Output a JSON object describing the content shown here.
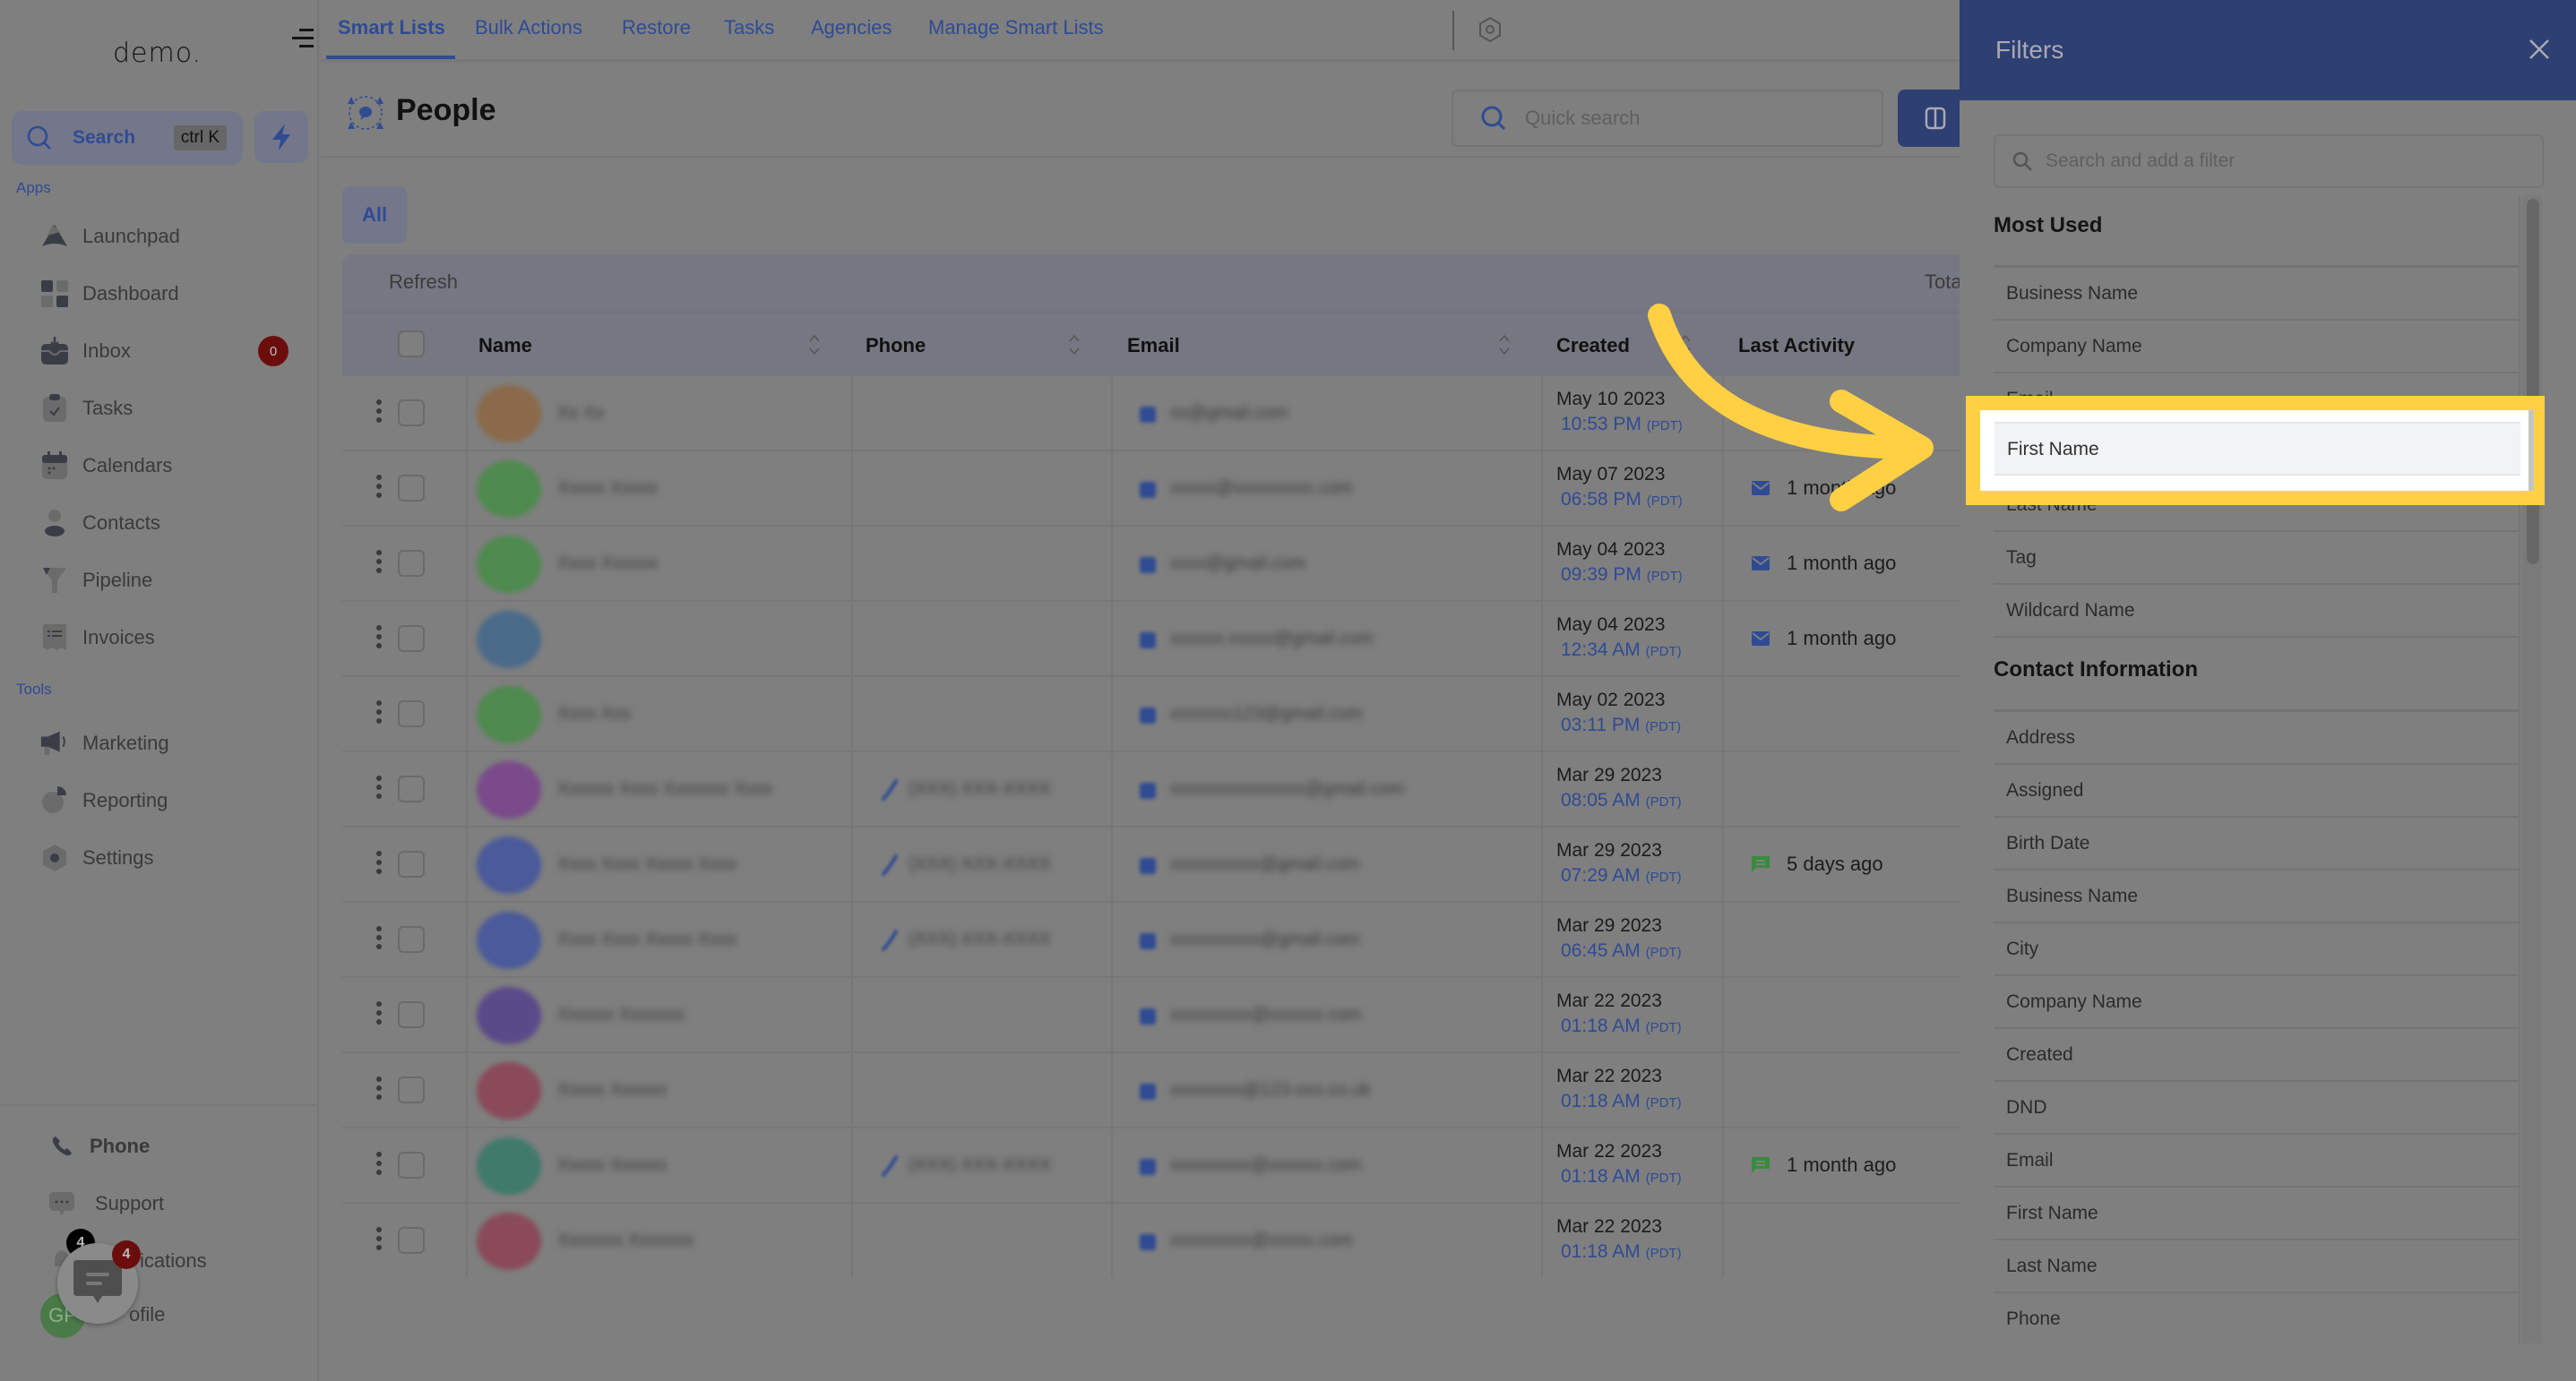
{
  "sidebar": {
    "logo": "demo.",
    "search_label": "Search",
    "search_shortcut": "ctrl K",
    "apps_label": "Apps",
    "tools_label": "Tools",
    "apps": [
      {
        "label": "Launchpad",
        "icon": "rocket-icon"
      },
      {
        "label": "Dashboard",
        "icon": "dashboard-icon"
      },
      {
        "label": "Inbox",
        "icon": "inbox-icon",
        "badge": "0"
      },
      {
        "label": "Tasks",
        "icon": "tasks-icon"
      },
      {
        "label": "Calendars",
        "icon": "calendar-icon"
      },
      {
        "label": "Contacts",
        "icon": "contacts-icon"
      },
      {
        "label": "Pipeline",
        "icon": "pipeline-icon"
      },
      {
        "label": "Invoices",
        "icon": "invoice-icon"
      }
    ],
    "tools": [
      {
        "label": "Marketing",
        "icon": "megaphone-icon"
      },
      {
        "label": "Reporting",
        "icon": "pie-chart-icon"
      },
      {
        "label": "Settings",
        "icon": "settings-icon"
      }
    ],
    "bottom": [
      {
        "label": "Phone",
        "icon": "phone-icon"
      },
      {
        "label": "Support",
        "icon": "support-icon"
      },
      {
        "label": "Notifications",
        "icon": "bell-icon",
        "visible_text": "ications",
        "badge": "4"
      },
      {
        "label": "Profile",
        "icon": "avatar",
        "visible_text": "ofile",
        "initials": "GP"
      }
    ],
    "chat_widget_badge": "4"
  },
  "topbar": {
    "tabs": [
      {
        "label": "Smart Lists",
        "active": true
      },
      {
        "label": "Bulk Actions"
      },
      {
        "label": "Restore"
      },
      {
        "label": "Tasks"
      },
      {
        "label": "Agencies"
      },
      {
        "label": "Manage Smart Lists"
      }
    ]
  },
  "page": {
    "title": "People",
    "quick_search_placeholder": "Quick search",
    "list_tab": "All",
    "refresh_label": "Refresh",
    "total_label": "Tota"
  },
  "table": {
    "columns": [
      "Name",
      "Phone",
      "Email",
      "Created",
      "Last Activity"
    ],
    "rows": [
      {
        "avatar_color": "#8a6a4a",
        "name": "Xx Xx",
        "phone": "",
        "email": "xx@gmail.com",
        "date": "May 10 2023",
        "time": "10:53 PM",
        "tz": "(PDT)",
        "activity": "",
        "activity_icon": ""
      },
      {
        "avatar_color": "#4f8a4f",
        "name": "Xxxxx Xxxxx",
        "phone": "",
        "email": "xxxxx@xxxxxxxxx.com",
        "date": "May 07 2023",
        "time": "06:58 PM",
        "tz": "(PDT)",
        "activity": "1 month ago",
        "activity_icon": "email"
      },
      {
        "avatar_color": "#4f8a4f",
        "name": "Xxxx Xxxxxx",
        "phone": "",
        "email": "xxxx@gmail.com",
        "date": "May 04 2023",
        "time": "09:39 PM",
        "tz": "(PDT)",
        "activity": "1 month ago",
        "activity_icon": "email"
      },
      {
        "avatar_color": "#4a6a8a",
        "name": "",
        "phone": "",
        "email": "xxxxxx.xxxxx@gmail.com",
        "date": "May 04 2023",
        "time": "12:34 AM",
        "tz": "(PDT)",
        "activity": "1 month ago",
        "activity_icon": "email"
      },
      {
        "avatar_color": "#4f8a4f",
        "name": "Xxxx Xxx",
        "phone": "",
        "email": "xxxxxxx123@gmail.com",
        "date": "May 02 2023",
        "time": "03:11 PM",
        "tz": "(PDT)",
        "activity": "",
        "activity_icon": ""
      },
      {
        "avatar_color": "#7a4a8a",
        "name": "Xxxxxx Xxxx Xxxxxxx Xxxx",
        "phone": "(XXX) XXX-XXXX",
        "email": "xxxxxxxxxxxxxxx@gmail.com",
        "date": "Mar 29 2023",
        "time": "08:05 AM",
        "tz": "(PDT)",
        "activity": "",
        "activity_icon": ""
      },
      {
        "avatar_color": "#4a5a9a",
        "name": "Xxxx Xxxx Xxxxx Xxxx",
        "phone": "(XXX) XXX-XXXX",
        "email": "xxxxxxxxxx@gmail.com",
        "date": "Mar 29 2023",
        "time": "07:29 AM",
        "tz": "(PDT)",
        "activity": "5 days ago",
        "activity_icon": "sms"
      },
      {
        "avatar_color": "#4a5a9a",
        "name": "Xxxx Xxxx Xxxxx Xxxx",
        "phone": "(XXX) XXX-XXXX",
        "email": "xxxxxxxxxx@gmail.com",
        "date": "Mar 29 2023",
        "time": "06:45 AM",
        "tz": "(PDT)",
        "activity": "",
        "activity_icon": ""
      },
      {
        "avatar_color": "#5a4a8a",
        "name": "Xxxxxx Xxxxxxx",
        "phone": "",
        "email": "xxxxxxxxx@xxxxxx.com",
        "date": "Mar 22 2023",
        "time": "01:18 AM",
        "tz": "(PDT)",
        "activity": "",
        "activity_icon": ""
      },
      {
        "avatar_color": "#8a4a5a",
        "name": "Xxxxx Xxxxxx",
        "phone": "",
        "email": "xxxxxxxx@123-xxx.co.uk",
        "date": "Mar 22 2023",
        "time": "01:18 AM",
        "tz": "(PDT)",
        "activity": "",
        "activity_icon": ""
      },
      {
        "avatar_color": "#3f7a6a",
        "name": "Xxxxx Xxxxxx",
        "phone": "(XXX) XXX-XXXX",
        "email": "xxxxxxxxx@xxxxxx.com",
        "date": "Mar 22 2023",
        "time": "01:18 AM",
        "tz": "(PDT)",
        "activity": "1 month ago",
        "activity_icon": "sms"
      },
      {
        "avatar_color": "#8a4a5a",
        "name": "Xxxxxxx Xxxxxxx",
        "phone": "",
        "email": "xxxxxxxxx@xxxxx.com",
        "date": "Mar 22 2023",
        "time": "01:18 AM",
        "tz": "(PDT)",
        "activity": "",
        "activity_icon": ""
      }
    ]
  },
  "filters": {
    "title": "Filters",
    "search_placeholder": "Search and add a filter",
    "groups": [
      {
        "title": "Most Used",
        "items": [
          "Business Name",
          "Company Name",
          "Email",
          "First Name",
          "Last Name",
          "Tag",
          "Wildcard Name"
        ]
      },
      {
        "title": "Contact Information",
        "items": [
          "Address",
          "Assigned",
          "Birth Date",
          "Business Name",
          "City",
          "Company Name",
          "Created",
          "DND",
          "Email",
          "First Name",
          "Last Name",
          "Phone"
        ]
      }
    ],
    "highlighted_item": "First Name"
  },
  "colors": {
    "accent": "#2f4b93",
    "panel_header": "#2e3f72",
    "highlight": "#ffd043",
    "badge_red": "#6c0d0d",
    "activity_email": "#2f4b93",
    "activity_sms": "#3a8a3f"
  }
}
